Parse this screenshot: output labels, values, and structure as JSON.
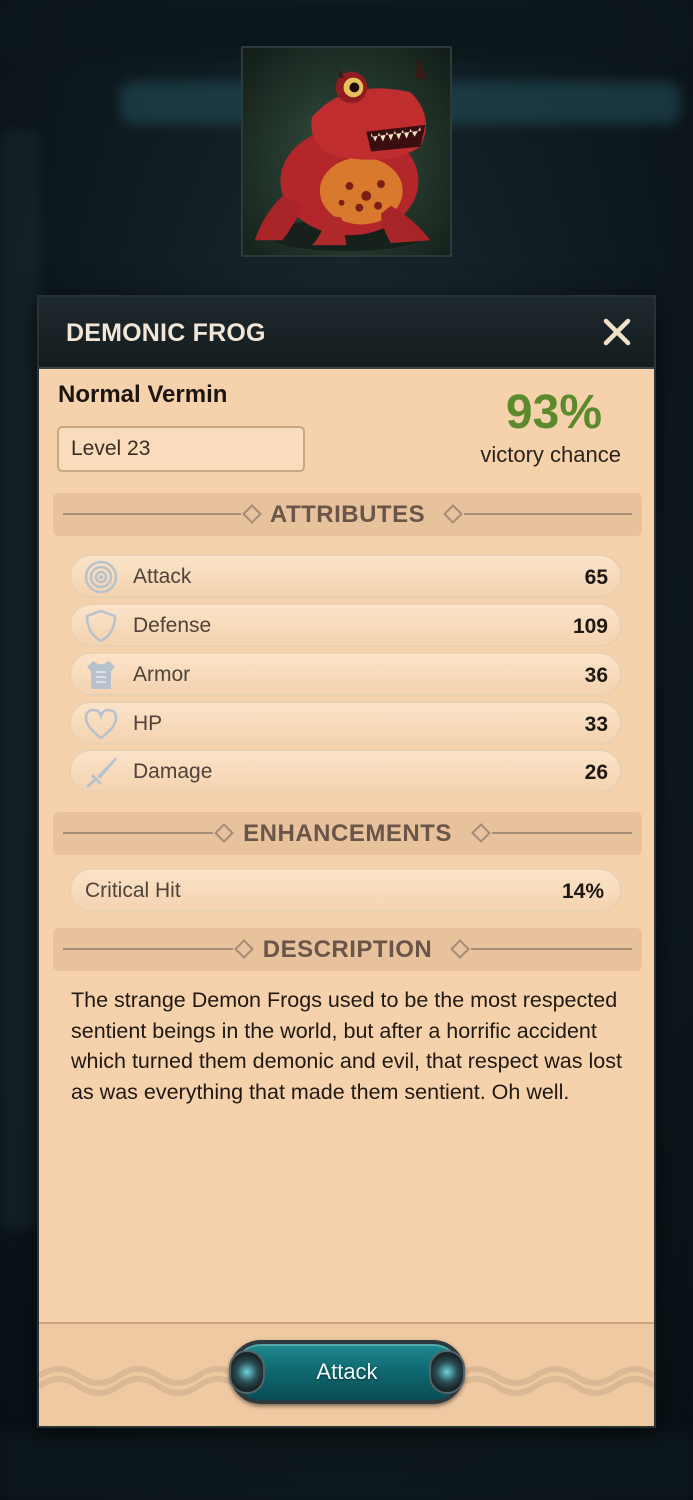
{
  "creature": {
    "name": "DEMONIC FROG",
    "rarity_type": "Normal Vermin",
    "level": "Level 23",
    "victory_percent": "93%",
    "victory_label": "victory chance"
  },
  "sections": {
    "attributes": "ATTRIBUTES",
    "enhancements": "ENHANCEMENTS",
    "description": "DESCRIPTION"
  },
  "attributes": [
    {
      "name": "Attack",
      "value": "65",
      "icon": "target-icon"
    },
    {
      "name": "Defense",
      "value": "109",
      "icon": "shield-icon"
    },
    {
      "name": "Armor",
      "value": "36",
      "icon": "armor-icon"
    },
    {
      "name": "HP",
      "value": "33",
      "icon": "heart-icon"
    },
    {
      "name": "Damage",
      "value": "26",
      "icon": "sword-icon"
    }
  ],
  "enhancements": [
    {
      "name": "Critical Hit",
      "value": "14%"
    }
  ],
  "description_text": "The strange Demon Frogs used to be the most respected sentient beings in the world, but after a horrific accident which turned them demonic and evil, that respect was lost as was everything that made them sentient.  Oh well.",
  "actions": {
    "attack_label": "Attack"
  },
  "colors": {
    "panel": "#f6d2ac",
    "title_bar": "#1a2326",
    "victory_green": "#5c8b2d",
    "button_teal": "#0f6a71"
  }
}
